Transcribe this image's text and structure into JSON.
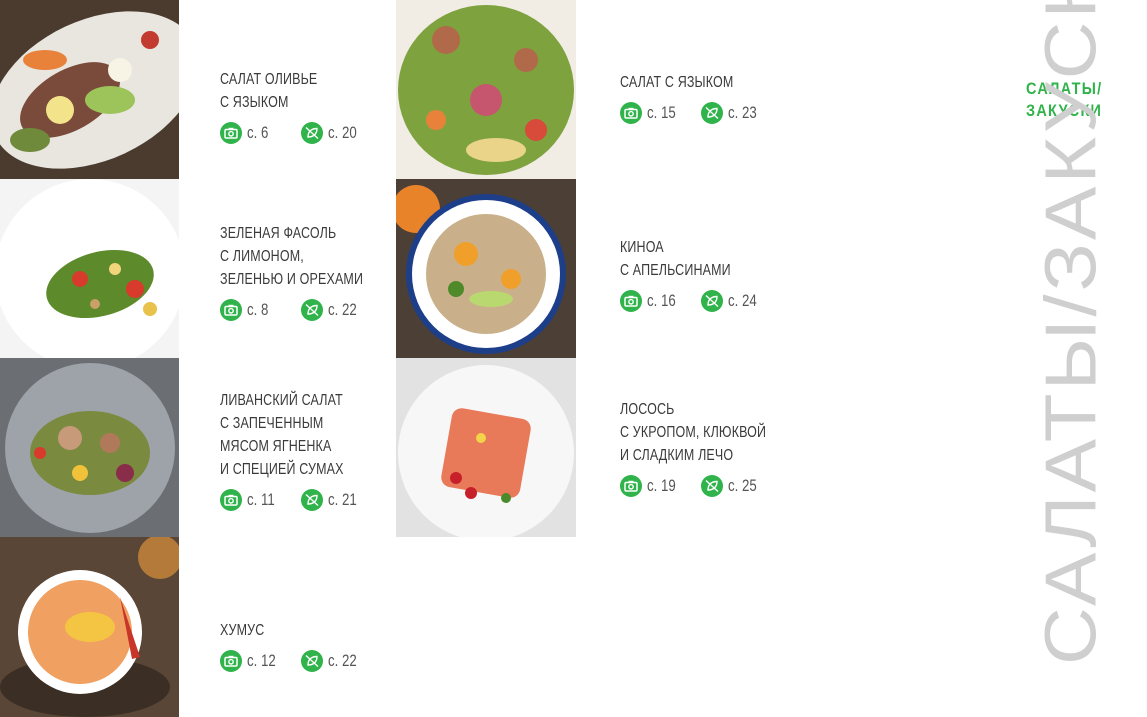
{
  "category": {
    "title_line1": "САЛАТЫ/",
    "title_line2": "ЗАКУСКИ",
    "vertical_title": "САЛАТЫ/ЗАКУСКИ",
    "accent_color": "#2fb34a"
  },
  "icons": {
    "photo": "camera-icon",
    "recipe": "leaf-crossed-icon"
  },
  "dishes": [
    {
      "lines": [
        "САЛАТ ОЛИВЬЕ",
        "С ЯЗЫКОМ"
      ],
      "photo_page": "с. 6",
      "recipe_page": "с. 20"
    },
    {
      "lines": [
        "ЗЕЛЕНАЯ ФАСОЛЬ",
        "С ЛИМОНОМ,",
        "ЗЕЛЕНЬЮ И ОРЕХАМИ"
      ],
      "photo_page": "с. 8",
      "recipe_page": "с. 22"
    },
    {
      "lines": [
        "ЛИВАНСКИЙ САЛАТ",
        "С ЗАПЕЧЕННЫМ",
        "МЯСОМ ЯГНЕНКА",
        "И СПЕЦИЕЙ СУМАХ"
      ],
      "photo_page": "с. 11",
      "recipe_page": "с. 21"
    },
    {
      "lines": [
        "ХУМУС"
      ],
      "photo_page": "с. 12",
      "recipe_page": "с. 22"
    },
    {
      "lines": [
        "САЛАТ С ЯЗЫКОМ"
      ],
      "photo_page": "с. 15",
      "recipe_page": "с. 23"
    },
    {
      "lines": [
        "КИНОА",
        "С АПЕЛЬСИНАМИ"
      ],
      "photo_page": "с. 16",
      "recipe_page": "с. 24"
    },
    {
      "lines": [
        "ЛОСОСЬ",
        "С УКРОПОМ, КЛЮКВОЙ",
        "И СЛАДКИМ ЛЕЧО"
      ],
      "photo_page": "с. 19",
      "recipe_page": "с. 25"
    }
  ]
}
